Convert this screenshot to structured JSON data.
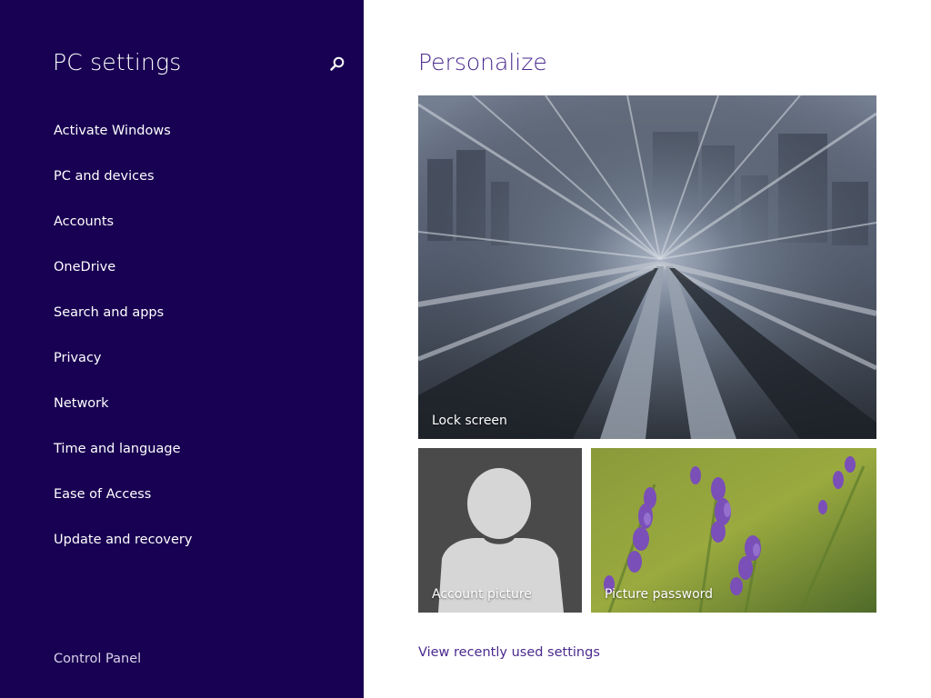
{
  "sidebar": {
    "title": "PC settings",
    "search_icon": "search-icon",
    "items": [
      {
        "label": "Activate Windows"
      },
      {
        "label": "PC and devices"
      },
      {
        "label": "Accounts"
      },
      {
        "label": "OneDrive"
      },
      {
        "label": "Search and apps"
      },
      {
        "label": "Privacy"
      },
      {
        "label": "Network"
      },
      {
        "label": "Time and language"
      },
      {
        "label": "Ease of Access"
      },
      {
        "label": "Update and recovery"
      }
    ],
    "footer_link": "Control Panel"
  },
  "main": {
    "title": "Personalize",
    "tiles": {
      "lock_screen": {
        "label": "Lock screen"
      },
      "account_picture": {
        "label": "Account picture"
      },
      "picture_password": {
        "label": "Picture password"
      }
    },
    "recent_link": "View recently used settings"
  },
  "colors": {
    "sidebar_bg": "#180052",
    "accent": "#4a2a8f",
    "content_bg": "#ffffff"
  }
}
